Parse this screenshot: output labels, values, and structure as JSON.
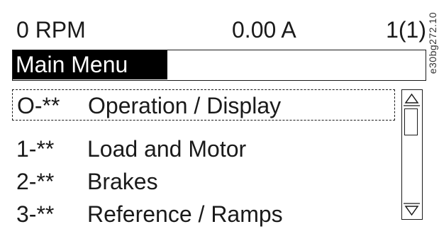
{
  "status": {
    "speed": "0 RPM",
    "current": "0.00 A",
    "setup": "1(1)"
  },
  "menu_title": "Main Menu",
  "menu_items": [
    {
      "number": "O-**",
      "label": "Operation / Display",
      "selected": true
    },
    {
      "number": "1-**",
      "label": "Load and Motor",
      "selected": false
    },
    {
      "number": "2-**",
      "label": "Brakes",
      "selected": false
    },
    {
      "number": "3-**",
      "label": "Reference / Ramps",
      "selected": false
    }
  ],
  "drawing_code": "e30bg272.10"
}
